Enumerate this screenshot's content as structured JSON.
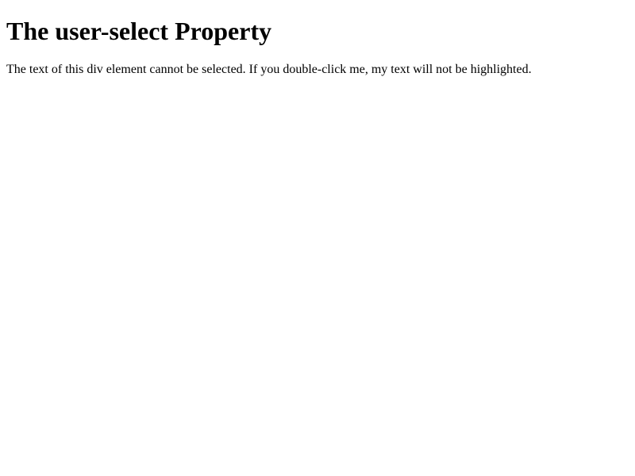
{
  "heading": "The user-select Property",
  "paragraph": "The text of this div element cannot be selected. If you double-click me, my text will not be highlighted."
}
